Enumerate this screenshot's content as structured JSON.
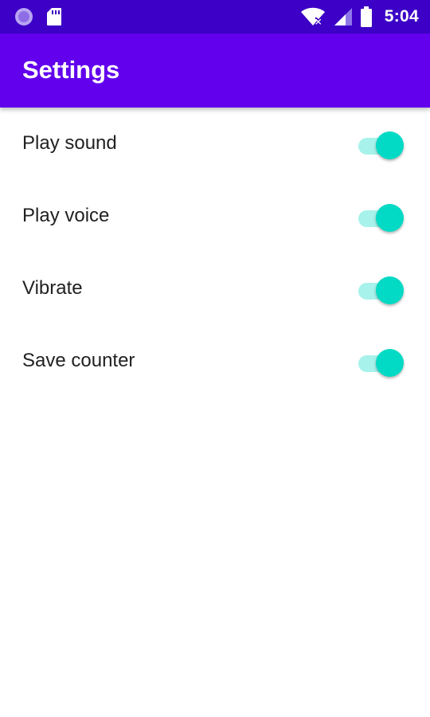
{
  "status_bar": {
    "time": "5:04",
    "background": "#3c00c6",
    "icons": [
      "notification-dot-icon",
      "sd-card-icon",
      "wifi-no-internet-icon",
      "cell-signal-icon",
      "battery-icon"
    ]
  },
  "app_bar": {
    "title": "Settings",
    "background": "#6200ee"
  },
  "settings": {
    "accent": "#03dac5",
    "items": [
      {
        "label": "Play sound",
        "enabled": true
      },
      {
        "label": "Play voice",
        "enabled": true
      },
      {
        "label": "Vibrate",
        "enabled": true
      },
      {
        "label": "Save counter",
        "enabled": true
      }
    ]
  }
}
